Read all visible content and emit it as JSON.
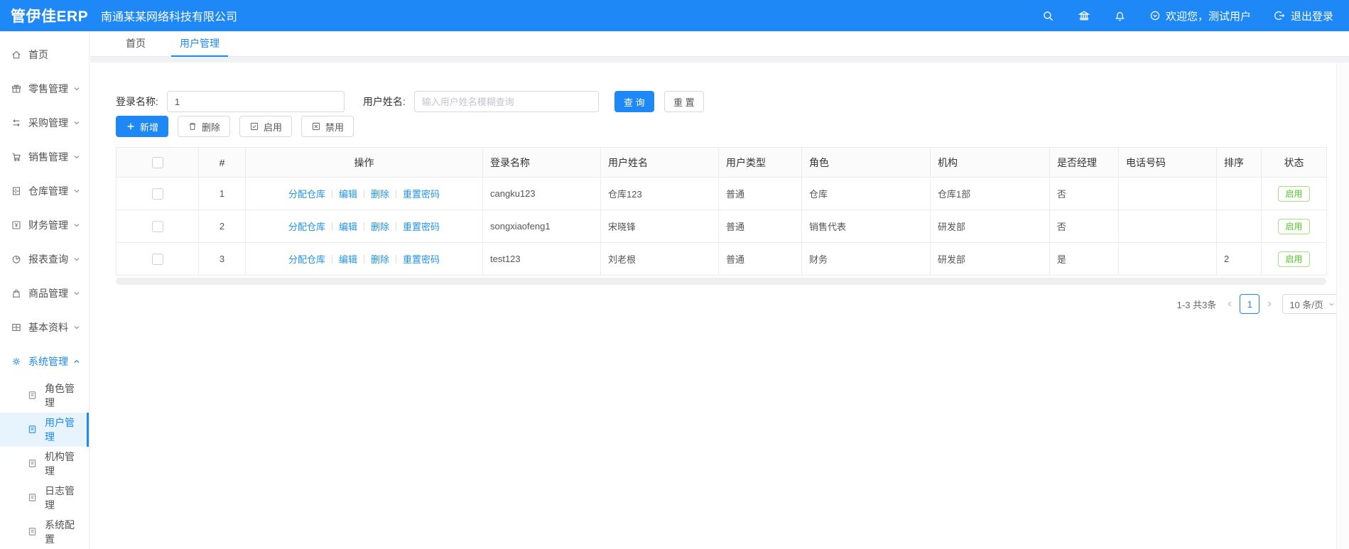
{
  "header": {
    "logo": "管伊佳ERP",
    "company": "南通某某网络科技有限公司",
    "welcome": "欢迎您，测试用户",
    "logout": "退出登录"
  },
  "tabs": [
    {
      "label": "首页"
    },
    {
      "label": "用户管理"
    }
  ],
  "sidebar": {
    "items": [
      {
        "label": "首页",
        "icon": "home-icon"
      },
      {
        "label": "零售管理",
        "icon": "retail-icon",
        "chevron": "down"
      },
      {
        "label": "采购管理",
        "icon": "purchase-icon",
        "chevron": "down"
      },
      {
        "label": "销售管理",
        "icon": "sales-icon",
        "chevron": "down"
      },
      {
        "label": "仓库管理",
        "icon": "warehouse-icon",
        "chevron": "down"
      },
      {
        "label": "财务管理",
        "icon": "finance-icon",
        "chevron": "down"
      },
      {
        "label": "报表查询",
        "icon": "report-icon",
        "chevron": "down"
      },
      {
        "label": "商品管理",
        "icon": "goods-icon",
        "chevron": "down"
      },
      {
        "label": "基本资料",
        "icon": "basic-data-icon",
        "chevron": "down"
      },
      {
        "label": "系统管理",
        "icon": "gear-icon",
        "chevron": "up",
        "active": true
      }
    ],
    "sub_items": [
      {
        "label": "角色管理"
      },
      {
        "label": "用户管理",
        "active": true
      },
      {
        "label": "机构管理"
      },
      {
        "label": "日志管理"
      },
      {
        "label": "系统配置"
      }
    ]
  },
  "filter": {
    "login_name_label": "登录名称:",
    "login_name_value": "1",
    "user_name_label": "用户姓名:",
    "user_name_placeholder": "输入用户姓名模糊查询",
    "search_button": "查 询",
    "reset_button": "重 置"
  },
  "toolbar": {
    "add": "新增",
    "delete": "删除",
    "enable": "启用",
    "disable": "禁用"
  },
  "table": {
    "headers": [
      "#",
      "操作",
      "登录名称",
      "用户姓名",
      "用户类型",
      "角色",
      "机构",
      "是否经理",
      "电话号码",
      "排序",
      "状态"
    ],
    "op_links": [
      "分配仓库",
      "编辑",
      "删除",
      "重置密码"
    ],
    "rows": [
      {
        "index": "1",
        "login": "cangku123",
        "name": "仓库123",
        "type": "普通",
        "role": "仓库",
        "org": "仓库1部",
        "manager": "否",
        "phone": "",
        "sort": "",
        "status": "启用"
      },
      {
        "index": "2",
        "login": "songxiaofeng1",
        "name": "宋晓锋",
        "type": "普通",
        "role": "销售代表",
        "org": "研发部",
        "manager": "否",
        "phone": "",
        "sort": "",
        "status": "启用"
      },
      {
        "index": "3",
        "login": "test123",
        "name": "刘老根",
        "type": "普通",
        "role": "财务",
        "org": "研发部",
        "manager": "是",
        "phone": "",
        "sort": "2",
        "status": "启用"
      }
    ]
  },
  "pagination": {
    "total": "1-3 共3条",
    "page": "1",
    "page_size": "10 条/页"
  },
  "colors": {
    "accent_blue": "#1e88f7",
    "link_blue": "#2193f0",
    "success_green": "#56c22d",
    "success_border": "#a8de87"
  }
}
